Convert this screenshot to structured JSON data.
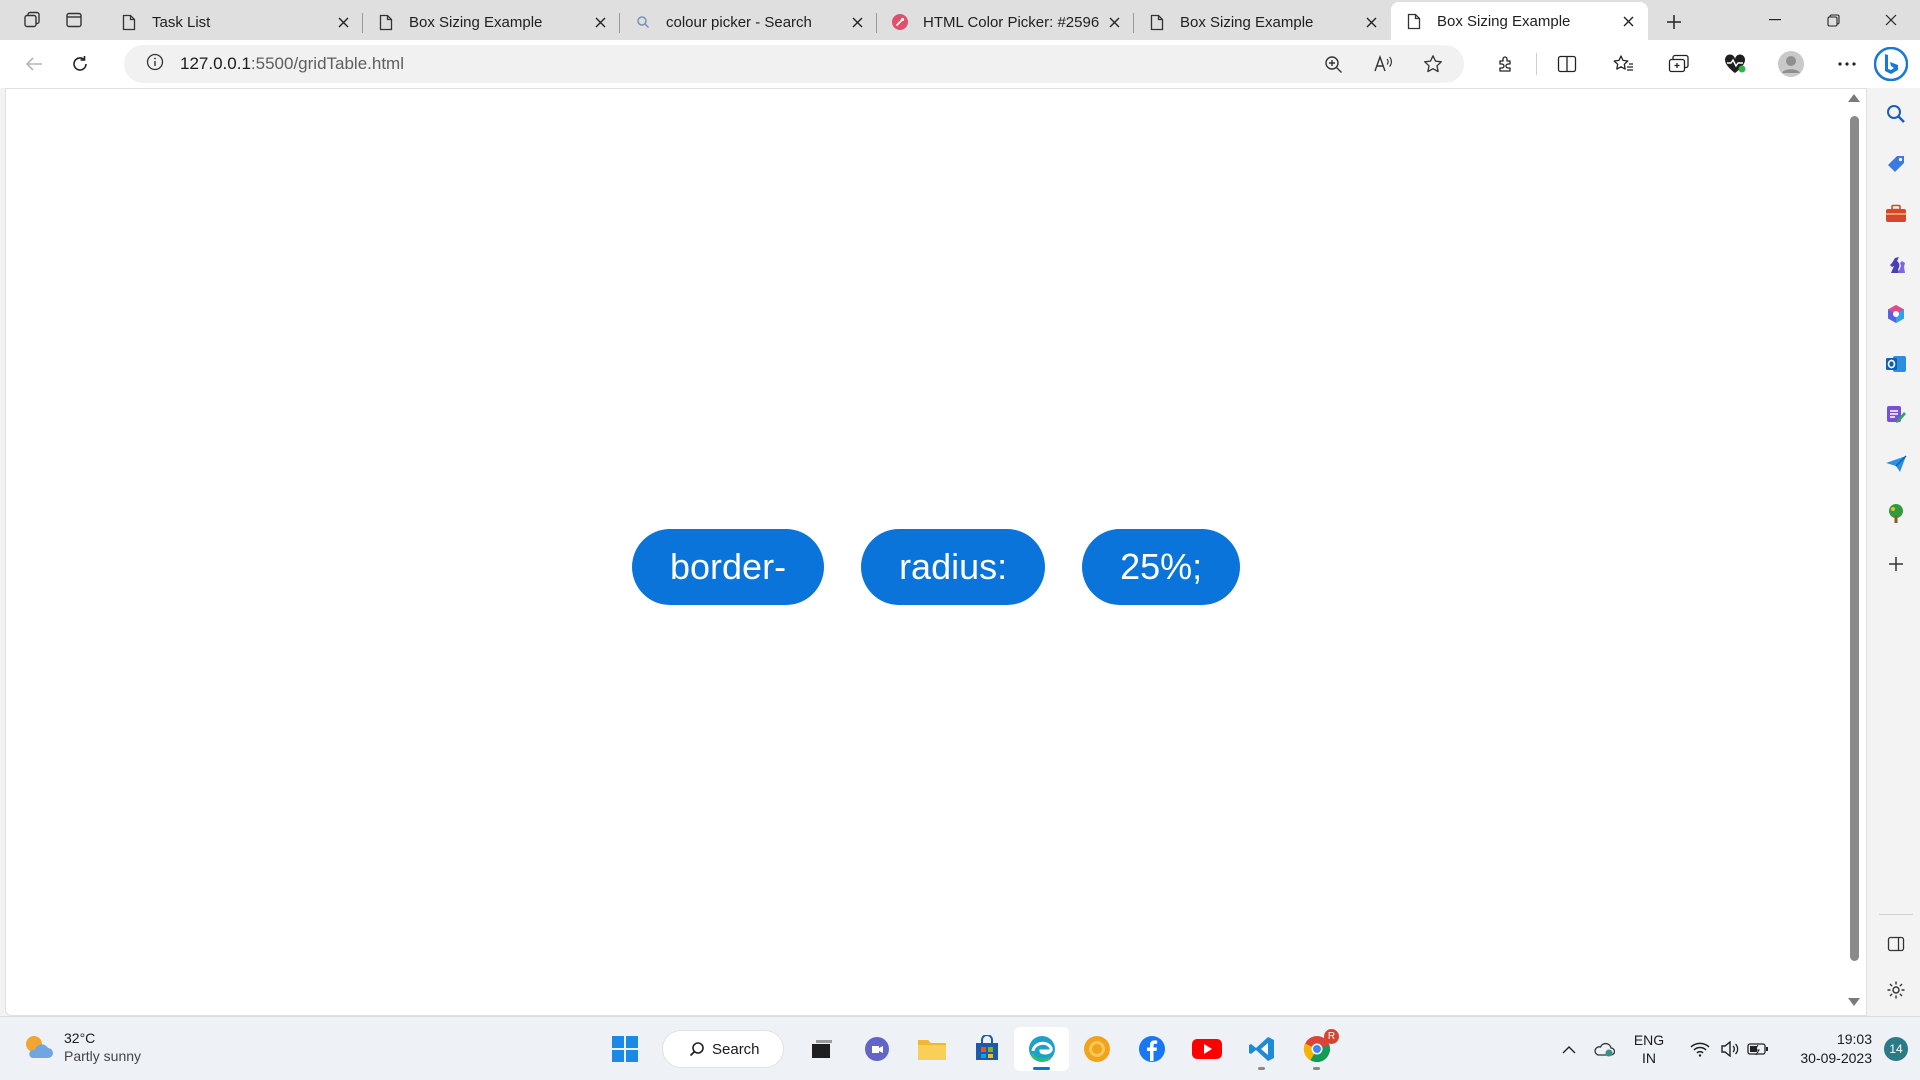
{
  "browser": {
    "tabs": [
      {
        "title": "Task List",
        "icon": "page-icon",
        "active": false
      },
      {
        "title": "Box Sizing Example",
        "icon": "page-icon",
        "active": false
      },
      {
        "title": "colour picker - Search",
        "icon": "search-icon",
        "active": false
      },
      {
        "title": "HTML Color Picker: #2596",
        "icon": "color-picker-icon",
        "active": false
      },
      {
        "title": "Box Sizing Example",
        "icon": "page-icon",
        "active": false
      },
      {
        "title": "Box Sizing Example",
        "icon": "page-icon",
        "active": true
      }
    ],
    "address": {
      "host": "127.0.0.1",
      "path": ":5500/gridTable.html"
    }
  },
  "page": {
    "pills": [
      "border-",
      "radius:",
      "25%;"
    ],
    "pill_color": "#0a74da",
    "background": "#ffffff"
  },
  "taskbar": {
    "weather": {
      "temp": "32°C",
      "condition": "Partly sunny"
    },
    "search_label": "Search",
    "language": {
      "line1": "ENG",
      "line2": "IN"
    },
    "clock": {
      "time": "19:03",
      "date": "30-09-2023"
    },
    "notifications": "14",
    "chrome_badge": "R"
  },
  "colors": {
    "accent": "#0a74da",
    "tabstrip": "#dfdfdf",
    "toolbar": "#ffffff"
  }
}
